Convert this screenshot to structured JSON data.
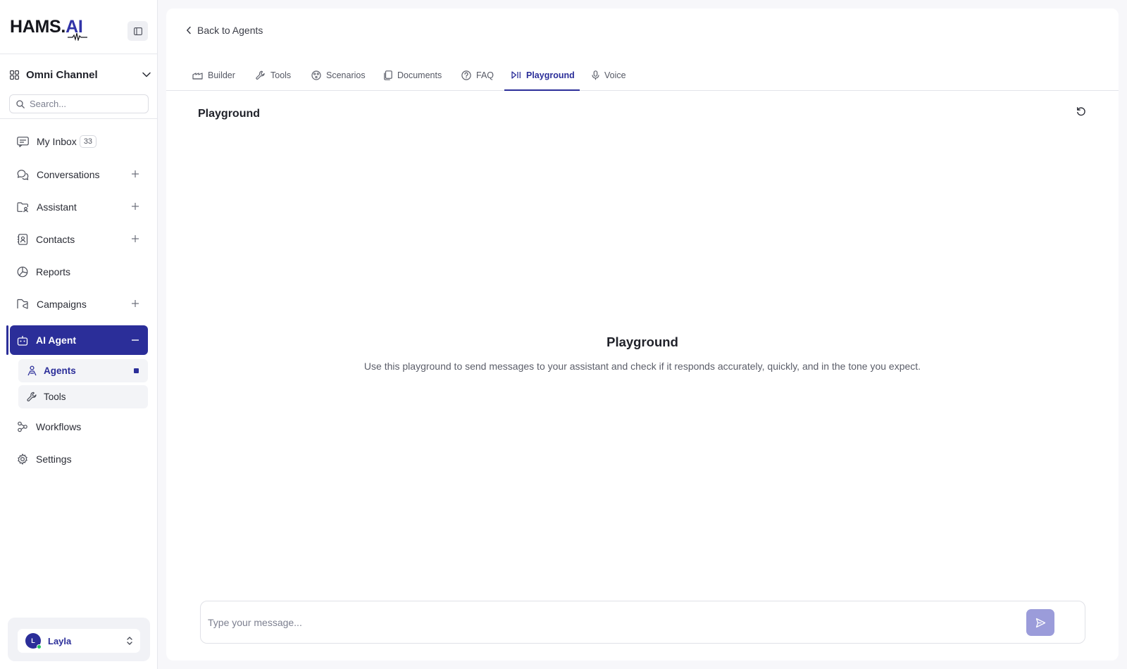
{
  "brand": {
    "name_prefix": "HAMS.",
    "name_suffix": "AI"
  },
  "workspace": {
    "name": "Omni Channel"
  },
  "search": {
    "placeholder": "Search..."
  },
  "nav": {
    "inbox": {
      "label": "My Inbox",
      "badge": "33"
    },
    "conversations": {
      "label": "Conversations"
    },
    "assistant": {
      "label": "Assistant"
    },
    "contacts": {
      "label": "Contacts"
    },
    "reports": {
      "label": "Reports"
    },
    "campaigns": {
      "label": "Campaigns"
    },
    "ai_agent": {
      "label": "AI Agent"
    },
    "agents": {
      "label": "Agents"
    },
    "tools": {
      "label": "Tools"
    },
    "workflows": {
      "label": "Workflows"
    },
    "settings": {
      "label": "Settings"
    }
  },
  "user": {
    "initial": "L",
    "name": "Layla"
  },
  "header": {
    "back_label": "Back to Agents"
  },
  "tabs": {
    "builder": "Builder",
    "tools": "Tools",
    "scenarios": "Scenarios",
    "documents": "Documents",
    "faq": "FAQ",
    "playground": "Playground",
    "voice": "Voice",
    "selected": "playground"
  },
  "playground": {
    "section_title": "Playground",
    "empty_title": "Playground",
    "empty_description": "Use this playground to send messages to your assistant and check if it responds accurately, quickly, and in the tone you expect."
  },
  "composer": {
    "placeholder": "Type your message..."
  },
  "colors": {
    "accent": "#2b2e99",
    "send_button": "#9b9cda",
    "online": "#22c55e"
  }
}
